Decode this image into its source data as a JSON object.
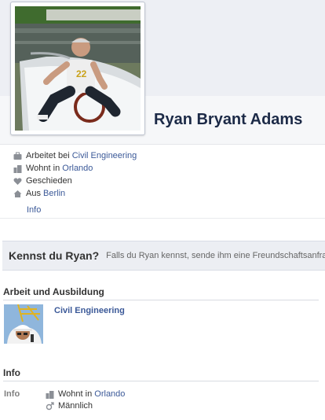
{
  "profile": {
    "name": "Ryan Bryant Adams",
    "photo_icon": "profile-photo-man-in-boat"
  },
  "facts": {
    "work": {
      "icon": "briefcase-icon",
      "prefix": "Arbeitet bei",
      "link": "Civil Engineering"
    },
    "lives": {
      "icon": "city-icon",
      "prefix": "Wohnt in",
      "link": "Orlando"
    },
    "relationship": {
      "icon": "heart-icon",
      "text": "Geschieden"
    },
    "from": {
      "icon": "house-icon",
      "prefix": "Aus",
      "link": "Berlin"
    }
  },
  "tabs": {
    "info": "Info"
  },
  "friend_prompt": {
    "question": "Kennst du Ryan?",
    "text": "Falls du Ryan kennst,",
    "link": "sende ihm eine Freundschaftsanfrage"
  },
  "work_section": {
    "title": "Arbeit und Ausbildung",
    "employer": "Civil Engineering",
    "employer_icon": "construction-worker-photo"
  },
  "info_section": {
    "title": "Info",
    "label": "Info",
    "lives": {
      "icon": "city-icon",
      "prefix": "Wohnt in",
      "link": "Orlando"
    },
    "gender": {
      "icon": "male-icon",
      "text": "Männlich"
    }
  },
  "colors": {
    "link": "#3b5998",
    "name": "#1c2a47",
    "background": "#ffffff",
    "band": "#edeff4"
  }
}
